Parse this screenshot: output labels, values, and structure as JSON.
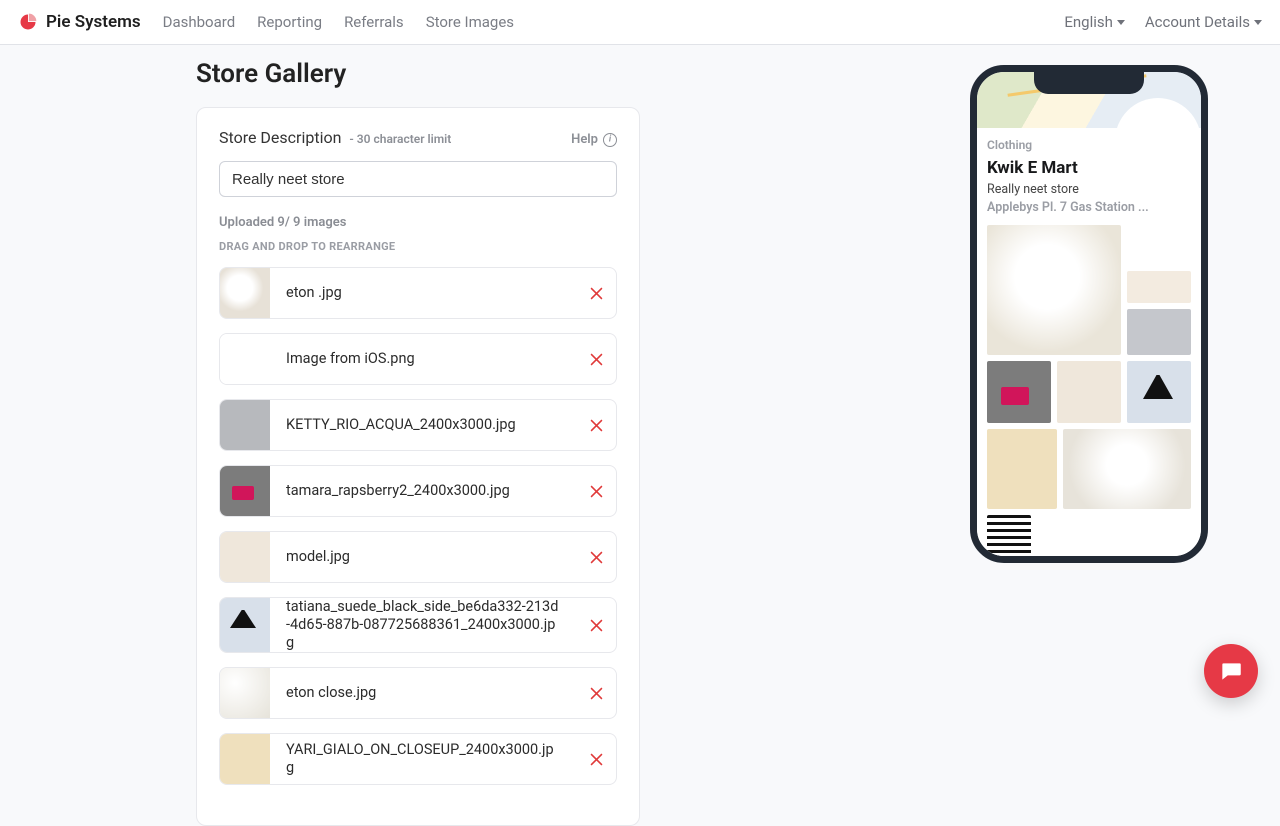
{
  "brand": {
    "name": "Pie Systems"
  },
  "nav": {
    "items": [
      "Dashboard",
      "Reporting",
      "Referrals",
      "Store Images"
    ]
  },
  "header_right": {
    "language": "English",
    "account": "Account Details"
  },
  "page": {
    "title": "Store Gallery"
  },
  "description_panel": {
    "label": "Store Description",
    "limit_text": "- 30 character limit",
    "help_label": "Help",
    "value": "Really neet store"
  },
  "upload_status": {
    "text": "Uploaded 9/ 9 images",
    "dnd_hint": "DRAG AND DROP TO REARRANGE"
  },
  "files": [
    {
      "name": "eton .jpg"
    },
    {
      "name": "Image from iOS.png"
    },
    {
      "name": "KETTY_RIO_ACQUA_2400x3000.jpg"
    },
    {
      "name": "tamara_rapsberry2_2400x3000.jpg"
    },
    {
      "name": "model.jpg"
    },
    {
      "name": "tatiana_suede_black_side_be6da332-213d-4d65-887b-087725688361_2400x3000.jpg"
    },
    {
      "name": "eton close.jpg"
    },
    {
      "name": "YARI_GIALO_ON_CLOSEUP_2400x3000.jpg"
    }
  ],
  "preview": {
    "category": "Clothing",
    "store_name": "Kwik E Mart",
    "store_desc": "Really neet store",
    "address": "Applebys Pl. 7 Gas Station ..."
  }
}
